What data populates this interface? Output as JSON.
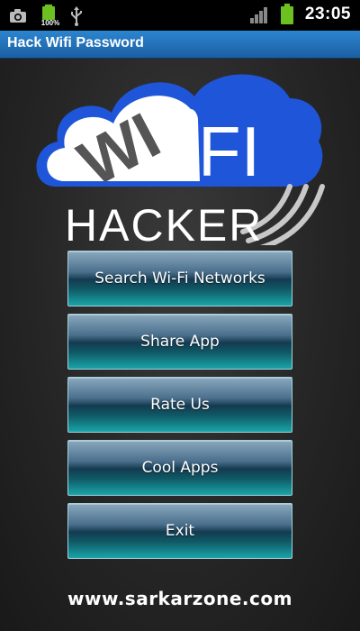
{
  "status_bar": {
    "icons": [
      "camera-icon",
      "battery-charging-icon",
      "usb-icon",
      "signal-icon",
      "battery-icon"
    ],
    "battery_percent": "100%",
    "time": "23:05",
    "battery_color": "#6cc020"
  },
  "app": {
    "title": "Hack Wifi Password",
    "title_bar_color": "#2878c0"
  },
  "logo": {
    "cloud_text": "WI",
    "fi_text": "FI",
    "hacker_text": "HACKER",
    "cloud_color": "#1f55d8"
  },
  "menu": {
    "items": [
      {
        "label": "Search Wi-Fi Networks"
      },
      {
        "label": "Share App"
      },
      {
        "label": "Rate Us"
      },
      {
        "label": "Cool Apps"
      },
      {
        "label": "Exit"
      }
    ]
  },
  "footer": {
    "url": "www.sarkarzone.com"
  }
}
